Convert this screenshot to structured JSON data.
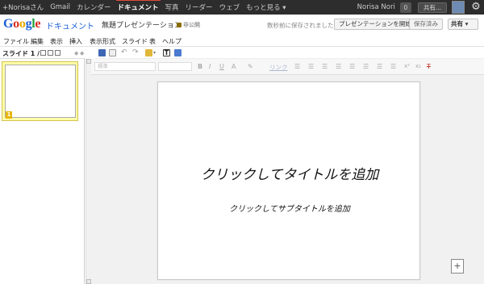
{
  "topbar": {
    "nav": [
      "+Norisaさん",
      "Gmail",
      "カレンダー",
      "ドキュメント",
      "写真",
      "リーダー",
      "ウェブ",
      "もっと見る ▾"
    ],
    "active": "ドキュメント",
    "user": "Norisa Nori",
    "badge": "0",
    "share": "共有...",
    "gear": "⚙"
  },
  "header": {
    "logo_letters": [
      "G",
      "o",
      "o",
      "g",
      "l",
      "e"
    ],
    "product": "ドキュメント",
    "title": "無題プレゼンテーション",
    "visibility": "非公開",
    "saved_status": "数秒前に保存されました",
    "present_button": "プレゼンテーションを開始",
    "saved_button": "保存済み",
    "share_button": "共有 ▾"
  },
  "menubar": [
    "ファイル",
    "編集",
    "表示",
    "挿入",
    "表示形式",
    "スライド",
    "表",
    "ヘルプ"
  ],
  "slides_panel": {
    "label": "スライド 1 / 1",
    "slide_number": "1"
  },
  "format_toolbar": {
    "style_select": "標準",
    "bold": "B",
    "italic": "I",
    "underline": "U",
    "text_color": "A",
    "link": "リンク",
    "superscript": "x²",
    "subscript": "x₂",
    "clear": "T"
  },
  "slide": {
    "title": "クリックしてタイトルを追加",
    "subtitle": "クリックしてサブタイトルを追加"
  },
  "canvas": {
    "add_comment_icon": "+"
  }
}
